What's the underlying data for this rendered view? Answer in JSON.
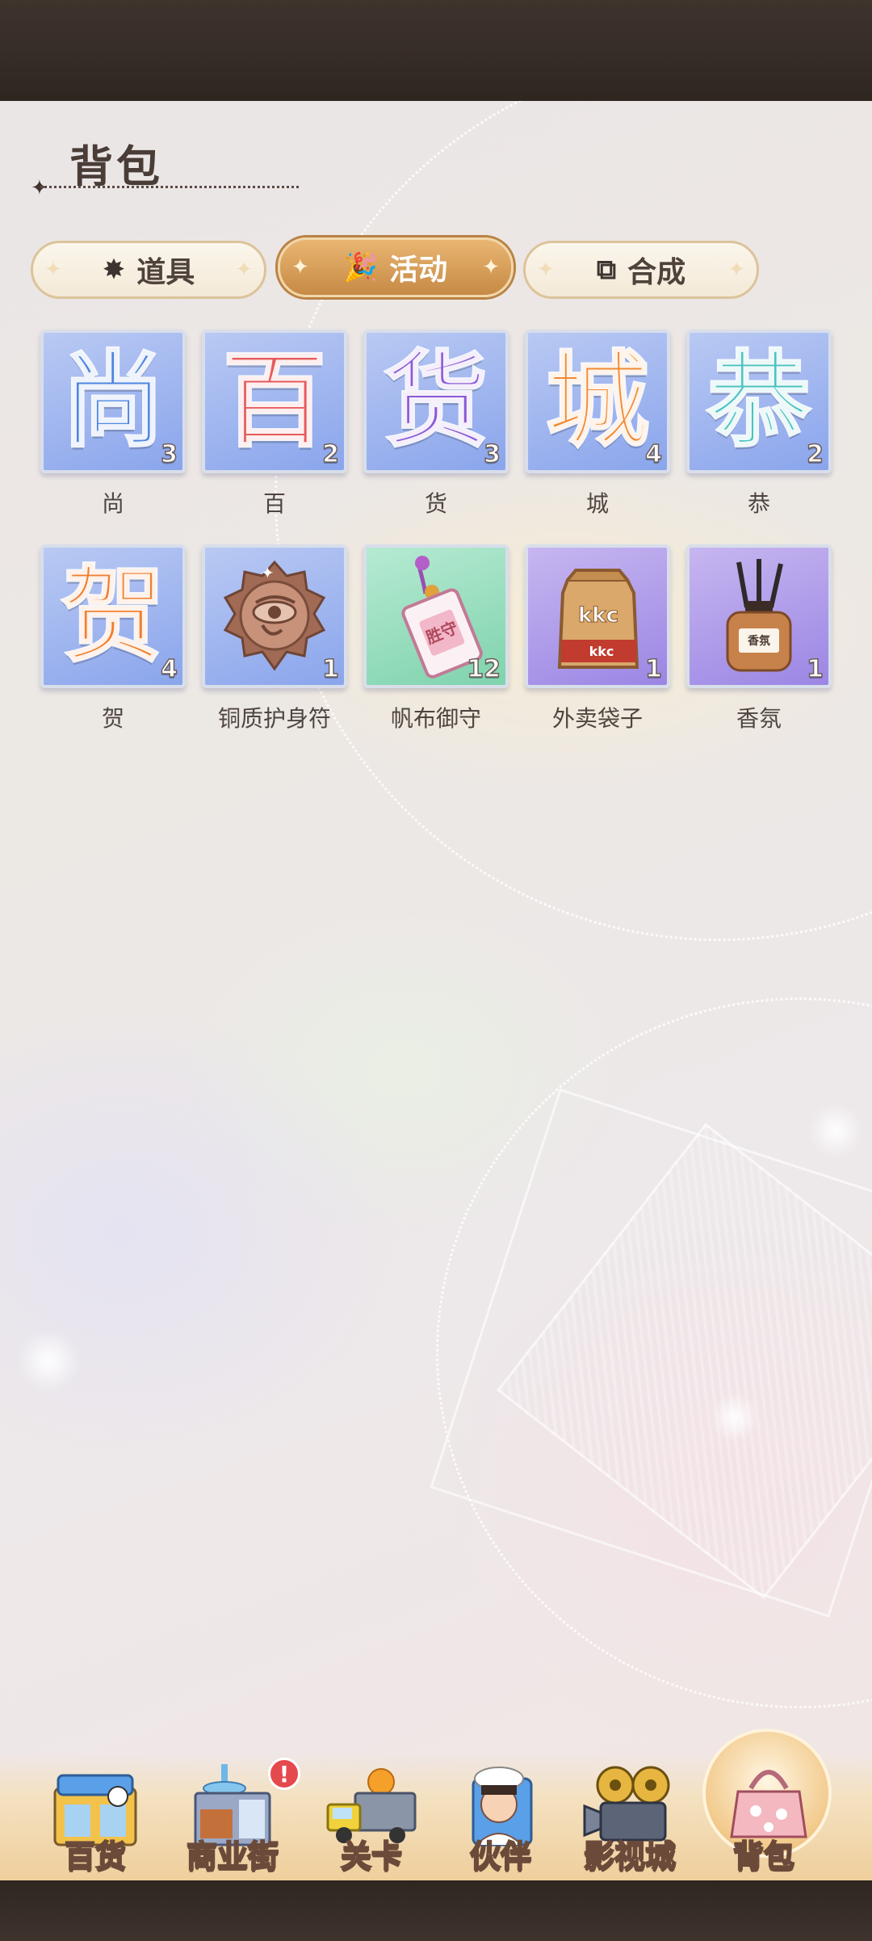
{
  "page": {
    "title": "背包"
  },
  "tabs": [
    {
      "label": "道具",
      "icon": "magic-wand-icon",
      "active": false
    },
    {
      "label": "活动",
      "icon": "party-popper-icon",
      "active": true
    },
    {
      "label": "合成",
      "icon": "combine-icon",
      "active": false
    }
  ],
  "items": [
    {
      "name": "尚",
      "glyph": "尚",
      "count": "3",
      "color": "#4f86e0",
      "tile": "blue"
    },
    {
      "name": "百",
      "glyph": "百",
      "count": "2",
      "color": "#e65a5a",
      "tile": "blue"
    },
    {
      "name": "货",
      "glyph": "货",
      "count": "3",
      "color": "#8a5ad6",
      "tile": "blue"
    },
    {
      "name": "城",
      "glyph": "城",
      "count": "4",
      "color": "#f08b35",
      "tile": "blue"
    },
    {
      "name": "恭",
      "glyph": "恭",
      "count": "2",
      "color": "#4cc3bf",
      "tile": "blue"
    },
    {
      "name": "贺",
      "glyph": "贺",
      "count": "4",
      "color": "#f07f2e",
      "tile": "blue"
    },
    {
      "name": "铜质护身符",
      "glyph": "",
      "count": "1",
      "color": "#b07a64",
      "tile": "blue",
      "icon": "copper-amulet-icon"
    },
    {
      "name": "帆布御守",
      "glyph": "",
      "count": "12",
      "color": "#f2c6d6",
      "tile": "green",
      "icon": "canvas-omamori-icon",
      "tag_text": "胜守"
    },
    {
      "name": "外卖袋子",
      "glyph": "",
      "count": "1",
      "color": "#c69a62",
      "tile": "purple",
      "icon": "takeout-bag-icon",
      "tag_text": "kkc"
    },
    {
      "name": "香氛",
      "glyph": "",
      "count": "1",
      "color": "#c08555",
      "tile": "purple",
      "icon": "reed-diffuser-icon",
      "tag_text": "香氛"
    }
  ],
  "nav": [
    {
      "label": "百货",
      "icon": "department-store-icon",
      "active": false
    },
    {
      "label": "商业街",
      "icon": "commercial-street-icon",
      "active": false,
      "badge": "!"
    },
    {
      "label": "关卡",
      "icon": "delivery-truck-icon",
      "active": false
    },
    {
      "label": "伙伴",
      "icon": "partner-chef-icon",
      "active": false
    },
    {
      "label": "影视城",
      "icon": "film-camera-icon",
      "active": false
    },
    {
      "label": "背包",
      "icon": "handbag-icon",
      "active": true
    }
  ]
}
